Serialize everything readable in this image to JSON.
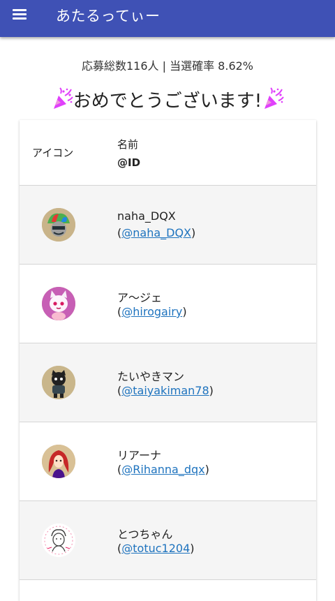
{
  "app": {
    "title": "あたるってぃー"
  },
  "stats_text": "応募総数116人 | 当選確率 8.62%",
  "congrats_text": "おめでとうございます!",
  "table": {
    "header": {
      "icon": "アイコン",
      "name": "名前",
      "id": "@ID"
    },
    "rows": [
      {
        "name": "naha_DQX",
        "id": "@naha_DQX",
        "avatar": "avatar-jester-icon"
      },
      {
        "name": "ア～ジェ",
        "id": "@hirogairy",
        "avatar": "avatar-pink-cat-icon"
      },
      {
        "name": "たいやきマン",
        "id": "@taiyakiman78",
        "avatar": "avatar-dark-character-icon"
      },
      {
        "name": "リアーナ",
        "id": "@Rihanna_dqx",
        "avatar": "avatar-red-hair-icon"
      },
      {
        "name": "とつちゃん",
        "id": "@totuc1204",
        "avatar": "avatar-sketch-icon"
      }
    ]
  },
  "colors": {
    "appbar": "#3f51b5",
    "link": "#1e73be",
    "row_alt": "#f5f5f5"
  }
}
